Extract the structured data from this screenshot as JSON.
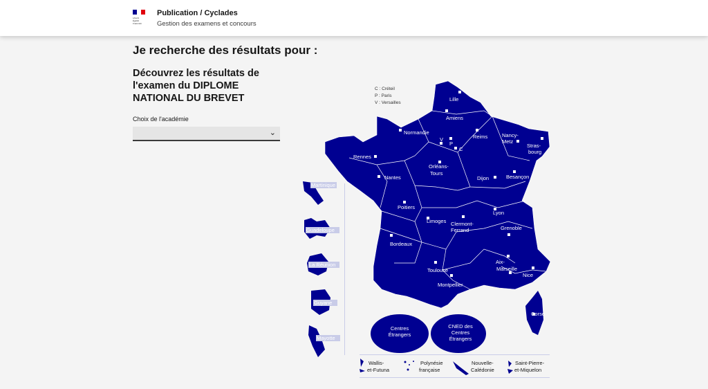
{
  "header": {
    "site_title": "Publication / Cyclades",
    "site_subtitle": "Gestion des examens et concours",
    "logo_text": [
      "Liberté",
      "Égalité",
      "Fraternité"
    ],
    "flag_colors": [
      "#000091",
      "#ffffff",
      "#e1000f"
    ]
  },
  "main": {
    "title": "Je recherche des résultats pour :",
    "exam_title": "Découvrez les résultats de l'examen du DIPLOME NATIONAL DU BREVET",
    "select_label": "Choix de l'académie",
    "select_value": ""
  },
  "map": {
    "legend": [
      "C : Créteil",
      "P : Paris",
      "V : Versailles"
    ],
    "academies": [
      "Lille",
      "Amiens",
      "Normandie",
      "Reims",
      "Nancy-",
      "Metz",
      "Stras-",
      "bourg",
      "V",
      "P",
      "C",
      "Rennes",
      "Nantes",
      "Orléans-",
      "Tours",
      "Dijon",
      "Besançon",
      "Poitiers",
      "Limoges",
      "Clermont-",
      "Ferrand",
      "Lyon",
      "Grenoble",
      "Bordeaux",
      "Toulouse",
      "Aix-",
      "Marseille",
      "Montpellier",
      "Nice",
      "Corse"
    ],
    "dom": [
      "Martinique",
      "Guadeloupe",
      "La Réunion",
      "Guyane",
      "Mayotte"
    ],
    "circles": [
      "Centres",
      "Étrangers",
      "CNED des",
      "Centres",
      "Étrangers"
    ],
    "com": [
      "Wallis-",
      "et-Futuna",
      "Polynésie",
      "française",
      "Nouvelle-",
      "Calédonie",
      "Saint-Pierre-",
      "et-Miquelon"
    ],
    "fill_color": "#000091"
  }
}
